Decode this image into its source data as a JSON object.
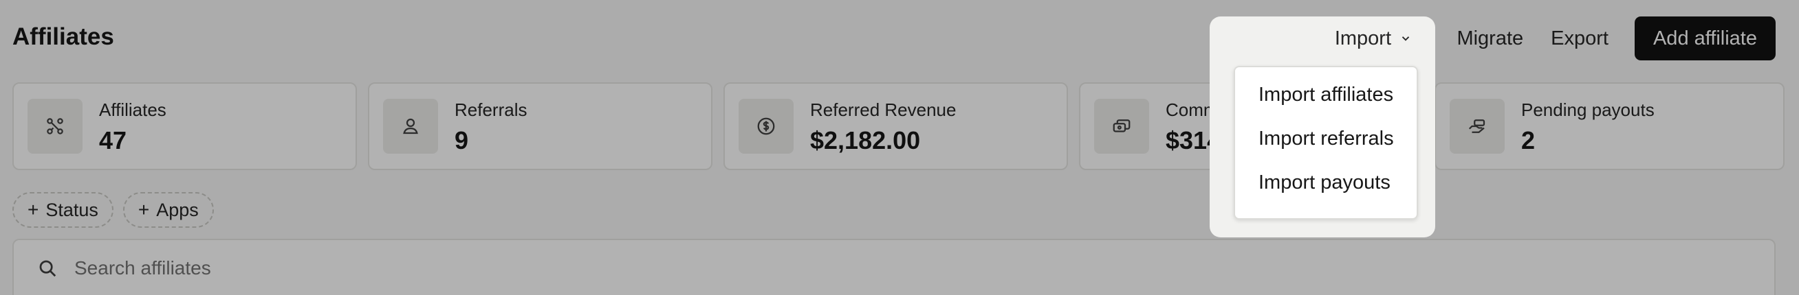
{
  "page": {
    "title": "Affiliates"
  },
  "header": {
    "import_label": "Import",
    "migrate_label": "Migrate",
    "export_label": "Export",
    "add_label": "Add affiliate"
  },
  "stats": [
    {
      "label": "Affiliates",
      "value": "47",
      "icon": "affiliates-network-icon"
    },
    {
      "label": "Referrals",
      "value": "9",
      "icon": "user-icon"
    },
    {
      "label": "Referred Revenue",
      "value": "$2,182.00",
      "icon": "dollar-circle-icon"
    },
    {
      "label": "Commissions",
      "value": "$314.60",
      "icon": "money-stack-icon"
    },
    {
      "label": "Pending payouts",
      "value": "2",
      "icon": "hand-cash-icon"
    }
  ],
  "filters": {
    "status_label": "Status",
    "apps_label": "Apps",
    "plus": "+"
  },
  "search": {
    "placeholder": "Search affiliates"
  },
  "import_menu": {
    "items": [
      "Import affiliates",
      "Import referrals",
      "Import payouts"
    ]
  },
  "colors": {
    "primary_button": "#121212",
    "overlay": "rgba(0,0,0,0.30)"
  }
}
